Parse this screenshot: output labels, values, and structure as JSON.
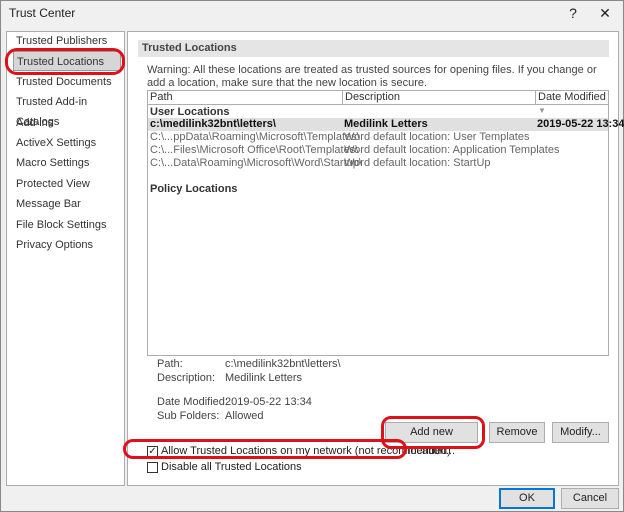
{
  "window": {
    "title": "Trust Center",
    "help": "?",
    "close": "✕"
  },
  "sidebar": {
    "items": [
      {
        "label": "Trusted Publishers"
      },
      {
        "label": "Trusted Locations",
        "selected": true
      },
      {
        "label": "Trusted Documents"
      },
      {
        "label": "Trusted Add-in Catalogs"
      },
      {
        "label": "Add-ins"
      },
      {
        "label": "ActiveX Settings"
      },
      {
        "label": "Macro Settings"
      },
      {
        "label": "Protected View"
      },
      {
        "label": "Message Bar"
      },
      {
        "label": "File Block Settings"
      },
      {
        "label": "Privacy Options"
      }
    ]
  },
  "main": {
    "header": "Trusted Locations",
    "warning": "Warning: All these locations are treated as trusted sources for opening files.  If you change or add a location, make sure that the new location is secure.",
    "table": {
      "columns": [
        "Path",
        "Description",
        "Date Modified"
      ],
      "user_group": "User Locations",
      "rows": [
        {
          "path": "c:\\medilink32bnt\\letters\\",
          "description": "Medilink Letters",
          "date": "2019-05-22 13:34",
          "selected": true
        },
        {
          "path": "C:\\...ppData\\Roaming\\Microsoft\\Templates\\",
          "description": "Word default location: User Templates",
          "date": ""
        },
        {
          "path": "C:\\...Files\\Microsoft Office\\Root\\Templates\\",
          "description": "Word default location: Application Templates",
          "date": ""
        },
        {
          "path": "C:\\...Data\\Roaming\\Microsoft\\Word\\Startup\\",
          "description": "Word default location: StartUp",
          "date": ""
        }
      ],
      "policy_group": "Policy Locations"
    },
    "details": {
      "path_label": "Path:",
      "path": "c:\\medilink32bnt\\letters\\",
      "desc_label": "Description:",
      "desc": "Medilink Letters",
      "date_label": "Date Modified:",
      "date": "2019-05-22 13:34",
      "sub_label": "Sub Folders:",
      "sub": "Allowed"
    },
    "buttons": {
      "add": "Add new location...",
      "remove": "Remove",
      "modify": "Modify..."
    },
    "checkboxes": [
      {
        "label": "Allow Trusted Locations on my network (not recommended)",
        "checked": true
      },
      {
        "label": "Disable all Trusted Locations",
        "checked": false
      }
    ]
  },
  "footer": {
    "ok": "OK",
    "cancel": "Cancel"
  },
  "annotation_color": "#e0101a"
}
